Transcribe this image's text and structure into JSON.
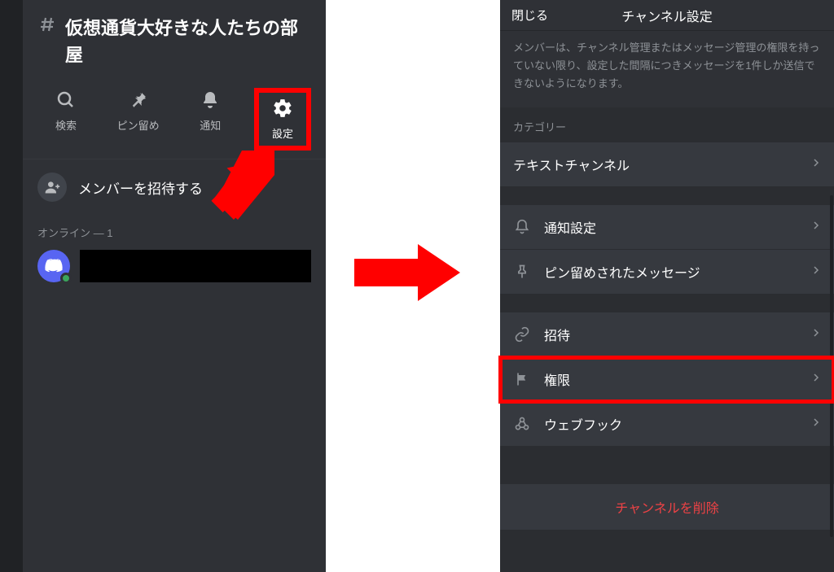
{
  "left": {
    "channel_name": "仮想通貨大好きな人たちの部屋",
    "actions": {
      "search": "検索",
      "pin": "ピン留め",
      "notify": "通知",
      "settings": "設定"
    },
    "invite_label": "メンバーを招待する",
    "online_label": "オンライン — 1"
  },
  "right": {
    "close": "閉じる",
    "title": "チャンネル設定",
    "desc": "メンバーは、チャンネル管理またはメッセージ管理の権限を持っていない限り、設定した間隔につきメッセージを1件しか送信できないようになります。",
    "category_label": "カテゴリー",
    "rows": {
      "text_channel": "テキストチャンネル",
      "notify_settings": "通知設定",
      "pinned_messages": "ピン留めされたメッセージ",
      "invite": "招待",
      "permissions": "権限",
      "webhook": "ウェブフック"
    },
    "delete": "チャンネルを削除"
  }
}
